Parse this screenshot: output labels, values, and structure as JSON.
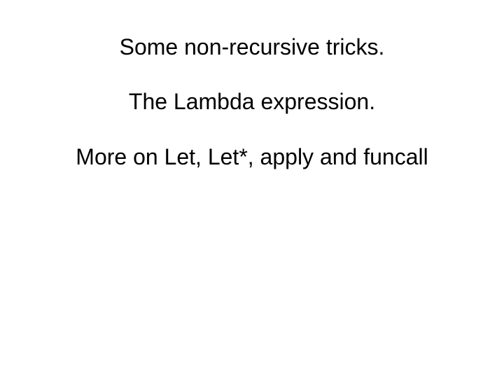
{
  "slide": {
    "line1": "Some non-recursive tricks.",
    "line2": "The Lambda expression.",
    "line3": "More on Let, Let*, apply and funcall"
  }
}
